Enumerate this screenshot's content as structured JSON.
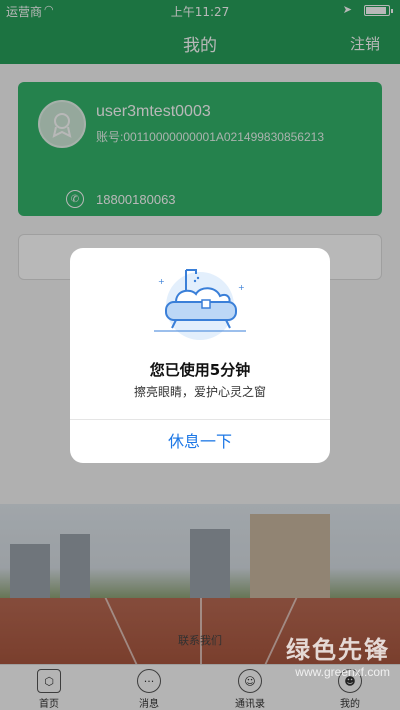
{
  "status_bar": {
    "carrier": "运营商",
    "time": "上午11:27",
    "battery_level": 0.9
  },
  "nav": {
    "title": "我的",
    "logout_label": "注销"
  },
  "user_card": {
    "username": "user3mtest0003",
    "account": "账号:00110000000001A021499830856213",
    "phone": "18800180063"
  },
  "footer": {
    "contact_label": "联系我们"
  },
  "tabs": [
    {
      "label": "首页",
      "icon": "home-hexagon-icon"
    },
    {
      "label": "消息",
      "icon": "message-bubble-icon"
    },
    {
      "label": "通讯录",
      "icon": "contacts-icon"
    },
    {
      "label": "我的",
      "icon": "profile-icon"
    }
  ],
  "modal": {
    "title": "您已使用5分钟",
    "subtitle": "擦亮眼睛，爱护心灵之窗",
    "button_label": "休息一下"
  },
  "watermark": {
    "title": "绿色先锋",
    "url": "www.greenxf.com"
  },
  "colors": {
    "brand_green": "#27a05a",
    "card_green": "#34b46b",
    "link_blue": "#1e78e6"
  }
}
